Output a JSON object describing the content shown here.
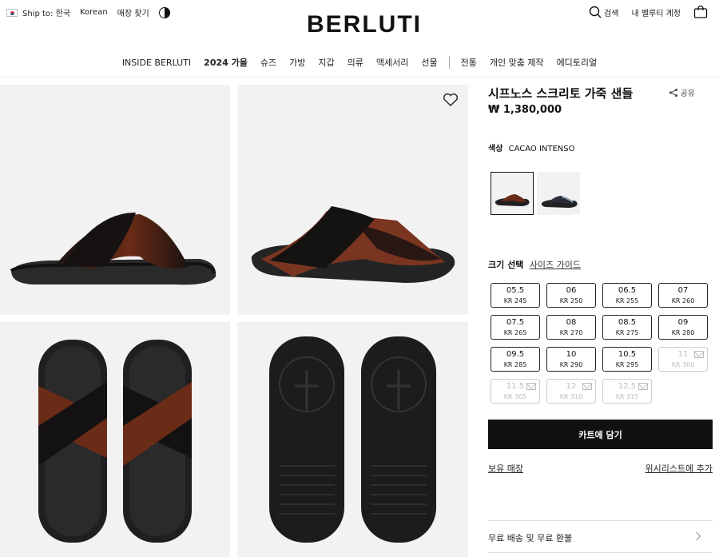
{
  "header": {
    "ship_to": "Ship to: 한국",
    "language": "Korean",
    "store_finder": "매장 찾기",
    "logo": "BERLUTI",
    "search": "검색",
    "account": "내 벨루티 계정"
  },
  "nav": {
    "items": [
      "INSIDE BERLUTI",
      "2024 가을",
      "슈즈",
      "가방",
      "지갑",
      "의류",
      "액세서리",
      "선물",
      "전통",
      "개인 맞춤 제작",
      "에디토리얼"
    ]
  },
  "product": {
    "title": "시프노스 스크리토 가죽 샌들",
    "share": "공유",
    "price": "₩ 1,380,000",
    "color_label": "색상",
    "color_value": "CACAO INTENSO",
    "size_label": "크기 선택",
    "size_guide": "사이즈 가이드",
    "sizes": [
      {
        "eu": "05.5",
        "kr": "KR 245",
        "available": true
      },
      {
        "eu": "06",
        "kr": "KR 250",
        "available": true
      },
      {
        "eu": "06.5",
        "kr": "KR 255",
        "available": true
      },
      {
        "eu": "07",
        "kr": "KR 260",
        "available": true
      },
      {
        "eu": "07.5",
        "kr": "KR 265",
        "available": true
      },
      {
        "eu": "08",
        "kr": "KR 270",
        "available": true
      },
      {
        "eu": "08.5",
        "kr": "KR 275",
        "available": true
      },
      {
        "eu": "09",
        "kr": "KR 280",
        "available": true
      },
      {
        "eu": "09.5",
        "kr": "KR 285",
        "available": true
      },
      {
        "eu": "10",
        "kr": "KR 290",
        "available": true
      },
      {
        "eu": "10.5",
        "kr": "KR 295",
        "available": true
      },
      {
        "eu": "11",
        "kr": "KR 300",
        "available": false
      },
      {
        "eu": "11.5",
        "kr": "KR 305",
        "available": false
      },
      {
        "eu": "12",
        "kr": "KR 310",
        "available": false
      },
      {
        "eu": "12.5",
        "kr": "KR 315",
        "available": false
      }
    ],
    "add_to_cart": "카트에 담기",
    "stock_stores": "보유 매장",
    "wishlist": "위시리스트에 추가",
    "shipping": "무료 배송 및 무료 환불"
  },
  "colors": {
    "accent": "#111111",
    "leather_brown": "#7a3520",
    "tile_bg": "#f2f2f2"
  }
}
